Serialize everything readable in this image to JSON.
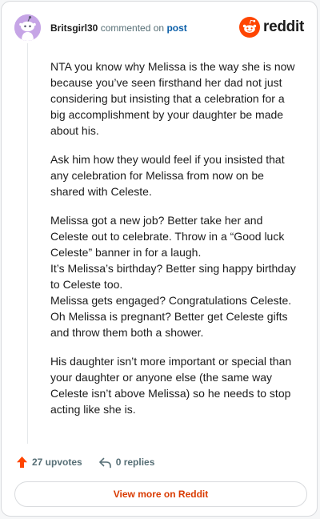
{
  "header": {
    "username": "Britsgirl30",
    "action_text": "commented on",
    "post_link_label": "post",
    "brand": "reddit"
  },
  "comment": {
    "paragraphs": [
      "NTA you know why Melissa is the way she is now because you’ve seen firsthand her dad not just considering but insisting that a celebration for a big accomplishment by your daughter be made about his.",
      "Ask him how they would feel if you insisted that any celebration for Melissa from now on be shared with Celeste.",
      "Melissa got a new job? Better take her and Celeste out to celebrate. Throw in a “Good luck Celeste” banner in for a laugh.\nIt’s Melissa’s birthday? Better sing happy birthday to Celeste too.\nMelissa gets engaged? Congratulations Celeste.\nOh Melissa is pregnant? Better get Celeste gifts and throw them both a shower.",
      "His daughter isn’t more important or special than your daughter or anyone else (the same way Celeste isn’t above Melissa) so he needs to stop acting like she is."
    ]
  },
  "actions": {
    "upvotes_label": "27 upvotes",
    "replies_label": "0 replies"
  },
  "footer": {
    "view_more_label": "View more on Reddit"
  },
  "icons": {
    "avatar": "snoo-avatar-icon",
    "brand": "reddit-logo-icon",
    "upvote": "upvote-arrow-icon",
    "reply": "reply-arrow-icon"
  },
  "colors": {
    "brand_orange": "#ff4500",
    "upvote_orange": "#ff4500",
    "link_blue": "#0a5ea8",
    "view_more_text": "#d93a00",
    "avatar_bg": "#c6a5e6",
    "muted_text": "#576f76"
  }
}
